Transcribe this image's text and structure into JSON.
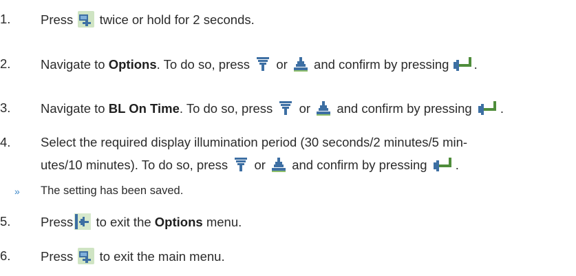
{
  "steps": [
    {
      "num": "1.",
      "t1": "Press",
      "t2": "twice or hold for 2 seconds."
    },
    {
      "num": "2.",
      "t1": "Navigate to",
      "bold1": "Options",
      "t2": ". To do so, press",
      "or": "or",
      "t3": "and confirm by pressing",
      "end": "."
    },
    {
      "num": "3.",
      "t1": "Navigate to",
      "bold1": "BL On Time",
      "t2": ". To do so, press",
      "or": "or",
      "t3": "and confirm by pressing",
      "end": "."
    },
    {
      "num": "4.",
      "line1": "Select the required display illumination period (30 seconds/2 minutes/5 min-",
      "line2": "utes/10 minutes). To do so, press",
      "or": "or",
      "t3": "and confirm by pressing",
      "end": "."
    },
    {
      "num": "5.",
      "t1": "Press",
      "t2": "to exit the",
      "bold1": "Options",
      "t3": "menu."
    },
    {
      "num": "6.",
      "t1": "Press",
      "t2": "to exit the main menu."
    }
  ],
  "result": {
    "marker": "»",
    "text": "The setting has been saved."
  },
  "icons": {
    "menu": "menu-key-icon",
    "down": "down-arrow-key-icon",
    "up": "up-arrow-key-icon",
    "enter": "enter-key-icon",
    "back": "back-key-icon",
    "color_icon_fill": "#4a7fb0",
    "color_icon_bg": "#d9ead0"
  }
}
